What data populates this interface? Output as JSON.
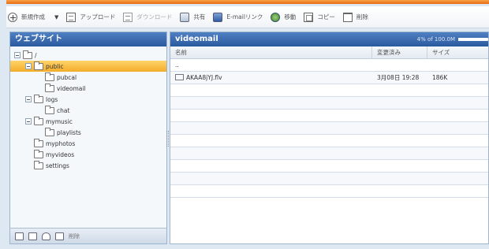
{
  "toolbar": {
    "new_label": "新規作成",
    "upload_label": "アップロード",
    "download_label": "ダウンロード",
    "share_label": "共有",
    "email_link_label": "E-mailリンク",
    "move_label": "移動",
    "copy_label": "コピー",
    "delete_label": "削除"
  },
  "left_panel": {
    "title": "ウェブサイト",
    "tree": [
      {
        "label": "/",
        "depth": 0,
        "expanded": true,
        "selected": false
      },
      {
        "label": "public",
        "depth": 1,
        "expanded": true,
        "selected": true
      },
      {
        "label": "pubcal",
        "depth": 2,
        "expanded": false,
        "selected": false
      },
      {
        "label": "videomail",
        "depth": 2,
        "expanded": false,
        "selected": false
      },
      {
        "label": "logs",
        "depth": 1,
        "expanded": true,
        "selected": false
      },
      {
        "label": "chat",
        "depth": 2,
        "expanded": false,
        "selected": false
      },
      {
        "label": "mymusic",
        "depth": 1,
        "expanded": true,
        "selected": false
      },
      {
        "label": "playlists",
        "depth": 2,
        "expanded": false,
        "selected": false
      },
      {
        "label": "myphotos",
        "depth": 1,
        "expanded": false,
        "selected": false
      },
      {
        "label": "myvideos",
        "depth": 1,
        "expanded": false,
        "selected": false
      },
      {
        "label": "settings",
        "depth": 1,
        "expanded": false,
        "selected": false
      }
    ],
    "footer_delete_label": "削除"
  },
  "right_panel": {
    "title": "videomail",
    "usage_text": "4% of 100.0M",
    "usage_fraction": 0.04,
    "columns": {
      "name": "名前",
      "modified": "変更済み",
      "size": "サイズ"
    },
    "rows": [
      {
        "name": "..",
        "modified": "",
        "size": "",
        "is_file": false
      },
      {
        "name": "AKAA8jYJ.flv",
        "modified": "3月08日 19:28",
        "size": "186K",
        "is_file": true
      }
    ],
    "empty_rows": 9
  }
}
